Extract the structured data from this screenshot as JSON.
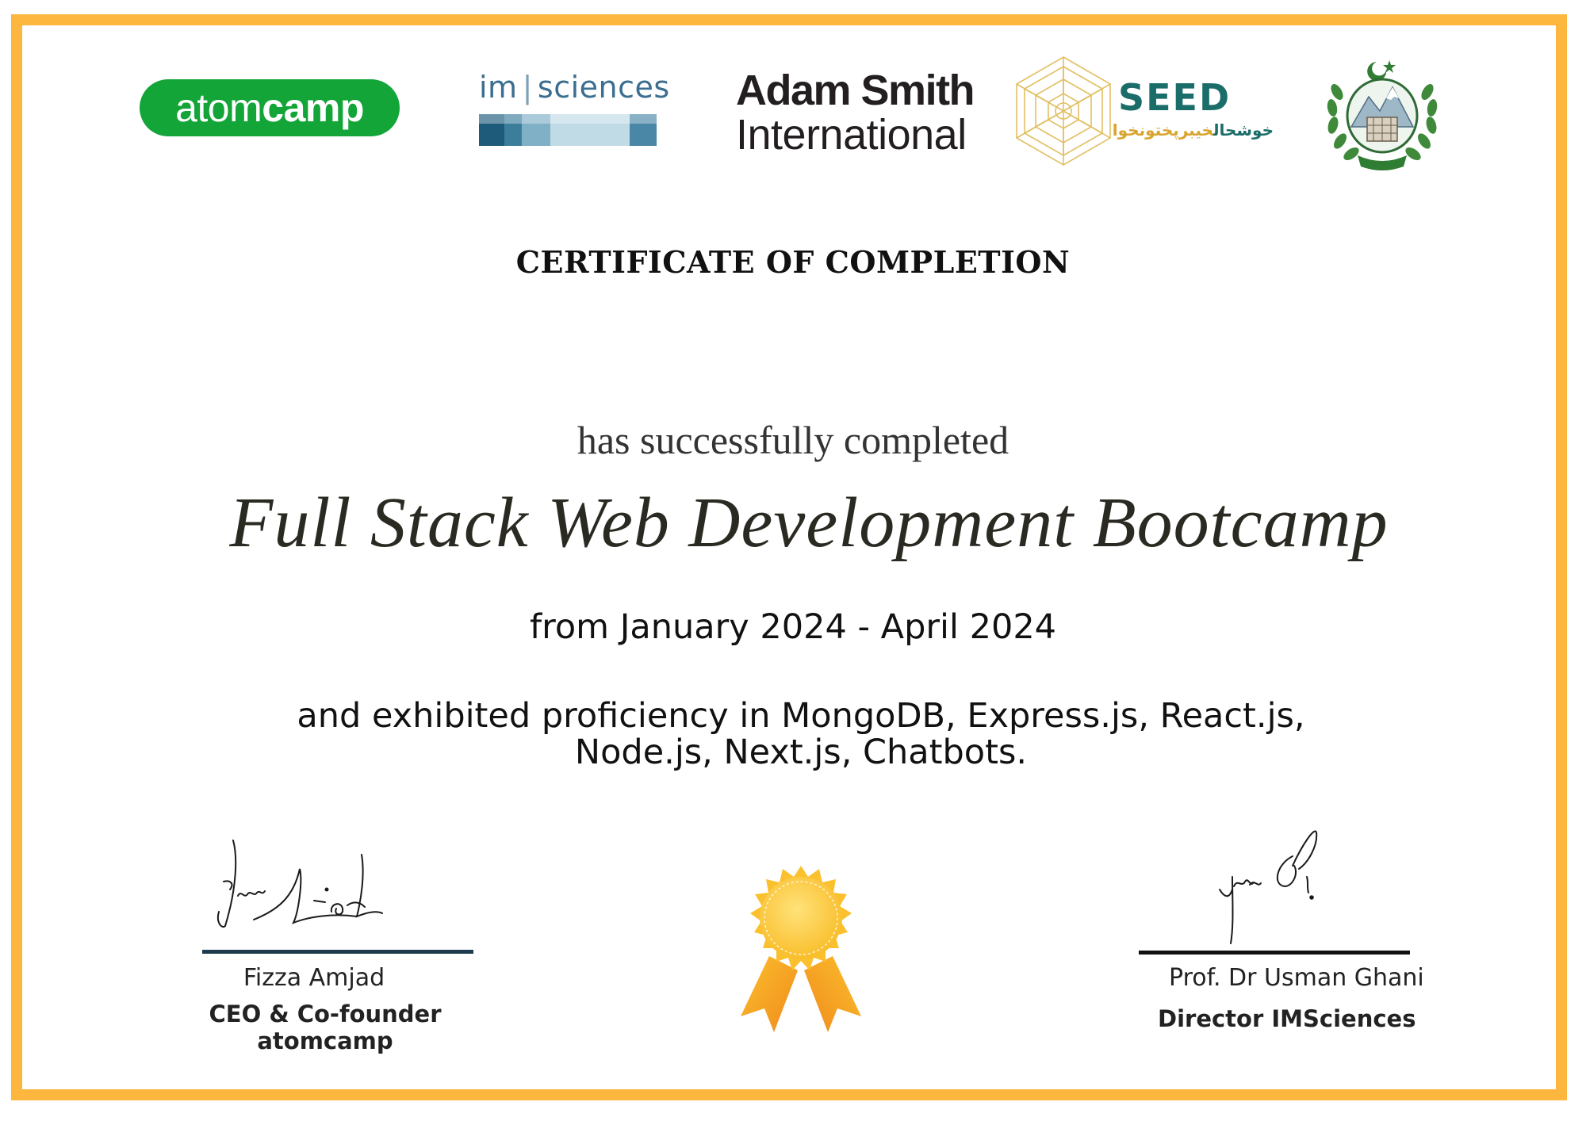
{
  "logos": {
    "atomcamp": {
      "text_regular": "atom",
      "text_bold": "camp",
      "color": "#13a538"
    },
    "imsciences": {
      "text_left": "im",
      "text_right": "sciences",
      "color": "#3b6e90"
    },
    "adam_smith": {
      "line1": "Adam Smith",
      "line2": "International"
    },
    "seed": {
      "title": "SEED",
      "urdu_dark": "خوشحال",
      "urdu_gold": "خیبرپختونخوا",
      "color": "#1b6d6a",
      "accent": "#d9a42e"
    },
    "kp_emblem": {
      "icon": "kp-government-emblem-icon"
    }
  },
  "certificate": {
    "title": "CERTIFICATE OF COMPLETION",
    "completed_text": "has successfully completed",
    "course": "Full Stack Web Development Bootcamp",
    "period": "from January 2024 - April 2024",
    "skills_line1": "and exhibited proficiency in MongoDB, Express.js, React.js,",
    "skills_line2": "Node.js, Next.js, Chatbots."
  },
  "signatories": [
    {
      "name": "Fizza Amjad",
      "title_line1": "CEO & Co-founder",
      "title_line2": "atomcamp"
    },
    {
      "name": "Prof. Dr Usman Ghani",
      "title_line1": "Director IMSciences"
    }
  ],
  "badge": {
    "icon": "award-ribbon-icon",
    "color": "#fbc02d"
  },
  "border_color": "#fdb73e"
}
